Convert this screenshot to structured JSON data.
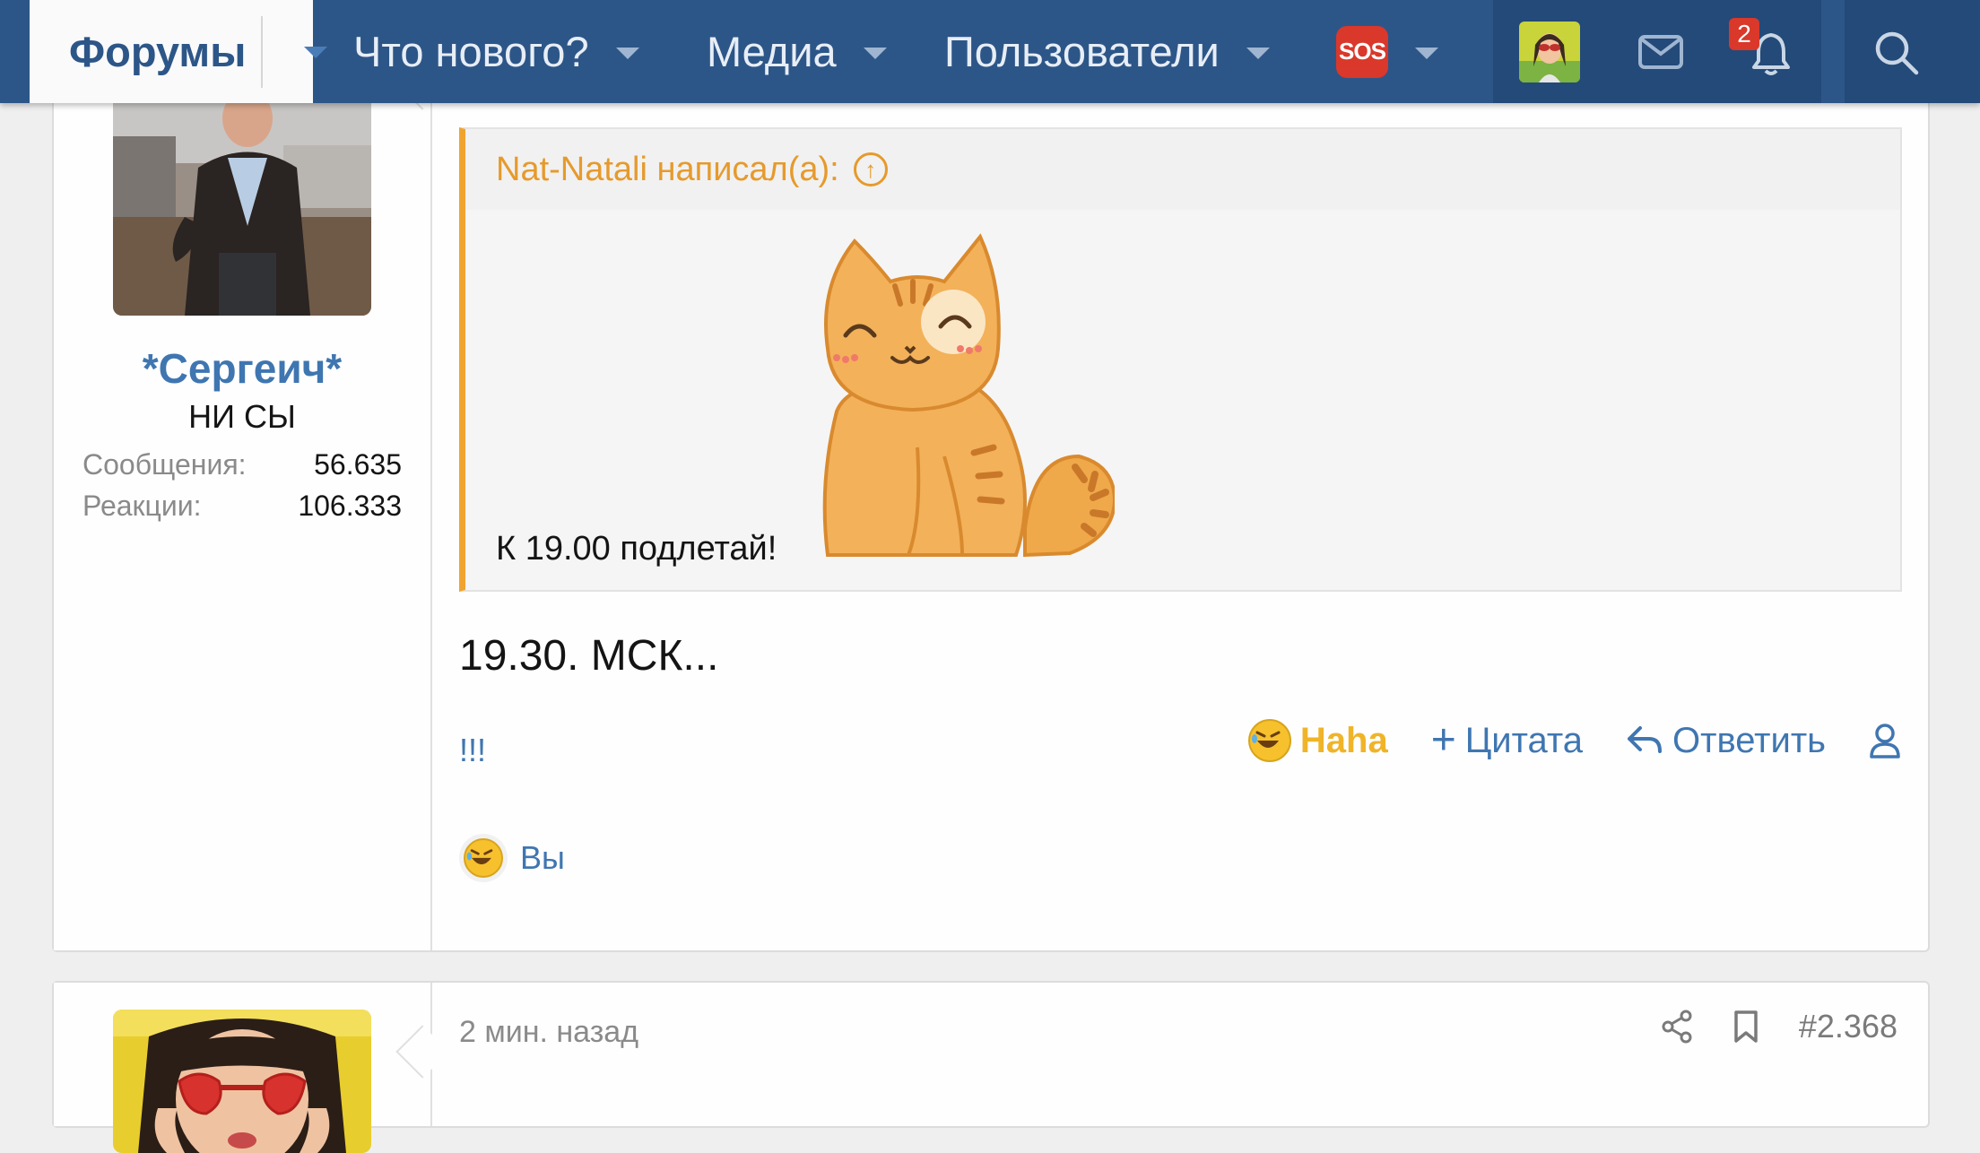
{
  "nav": {
    "forums": "Форумы",
    "whats_new": "Что нового?",
    "media": "Медиа",
    "members": "Пользователи",
    "sos": "SOS",
    "alerts_count": "2",
    "icons": [
      "chevron-down-icon",
      "envelope-icon",
      "bell-icon",
      "search-icon"
    ]
  },
  "post1": {
    "username": "*Сергеич*",
    "user_title": "НИ СЫ",
    "stats": [
      {
        "label": "Сообщения:",
        "value": "56.635"
      },
      {
        "label": "Реакции:",
        "value": "106.333"
      }
    ],
    "quote": {
      "author": "Nat-Natali написал(а):",
      "text": "К 19.00 подлетай!"
    },
    "body": "19.30. МСК...",
    "bangs": "!!!",
    "actions": {
      "reaction": "Haha",
      "quote": "Цитата",
      "reply": "Ответить"
    },
    "reactions_by": "Вы"
  },
  "post2": {
    "time": "2 мин. назад",
    "number": "#2.368"
  },
  "colors": {
    "nav": "#2d5688",
    "link": "#3f76b1",
    "quote_accent": "#f0a430",
    "haha": "#f0b429",
    "badge": "#d9382a"
  }
}
